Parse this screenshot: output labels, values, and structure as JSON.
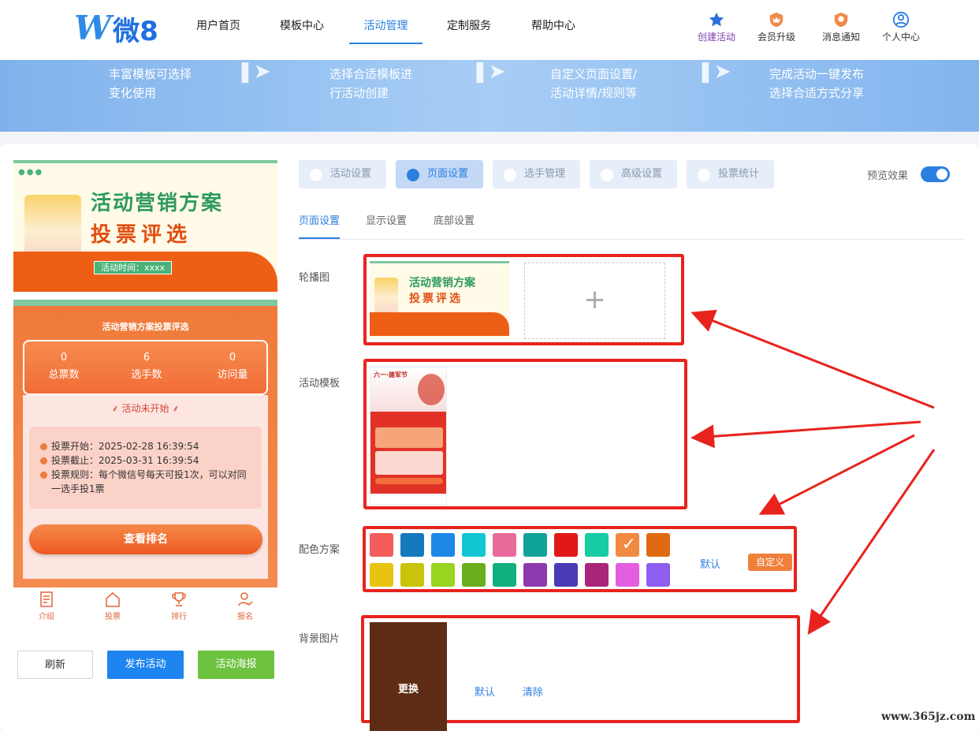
{
  "logo": {
    "w": "W",
    "text": "微8"
  },
  "nav": [
    "用户首页",
    "模板中心",
    "活动管理",
    "定制服务",
    "帮助中心"
  ],
  "user_actions": [
    "创建活动",
    "会员升级",
    "消息通知",
    "个人中心"
  ],
  "banner_steps": [
    [
      "丰富模板可选择",
      "变化使用"
    ],
    [
      "选择合适模板进",
      "行活动创建"
    ],
    [
      "自定义页面设置/",
      "活动详情/规则等"
    ],
    [
      "完成活动一键发布",
      "选择合适方式分享"
    ]
  ],
  "preview": {
    "cover_title1": "活动营销方案",
    "cover_title2": "投票评选",
    "cover_badge": "活动时间：xxxx",
    "page_title": "活动营销方案投票评选",
    "stats": [
      {
        "value": "0",
        "label": "总票数"
      },
      {
        "value": "6",
        "label": "选手数"
      },
      {
        "value": "0",
        "label": "访问量"
      }
    ],
    "status": "活动未开始",
    "rules": [
      "投票开始：2025-02-28 16:39:54",
      "投票截止：2025-03-31 16:39:54",
      "投票规则：每个微信号每天可投1次，可以对同一选手投1票"
    ],
    "rank_button": "查看排名",
    "tabbar": [
      "介绍",
      "投票",
      "排行",
      "报名"
    ]
  },
  "actions": {
    "refresh": "刷新",
    "publish": "发布活动",
    "poster": "活动海报"
  },
  "main_tabs": [
    "活动设置",
    "页面设置",
    "选手管理",
    "高级设置",
    "投票统计"
  ],
  "preview_toggle_label": "预览效果",
  "sub_tabs": [
    "页面设置",
    "显示设置",
    "底部设置"
  ],
  "fields": {
    "carousel": "轮播图",
    "template": "活动模板",
    "color": "配色方案",
    "background": "背景图片"
  },
  "upload_plus": "+",
  "colors_row1": [
    "#f25c5c",
    "#1479bd",
    "#1e87e8",
    "#12c6d3",
    "#e86a9a",
    "#10a39a",
    "#e11818",
    "#16cca4",
    "#f28a42",
    "#e06a12"
  ],
  "colors_row2": [
    "#e8c310",
    "#c9c309",
    "#98d420",
    "#6aad1d",
    "#0fb07e",
    "#8e3aaf",
    "#4a3ab6",
    "#a9257a",
    "#e35ee0",
    "#8e5ef0"
  ],
  "selected_color_check": "✓",
  "color_default": "默认",
  "color_custom": "自定义",
  "bg_change": "更换",
  "bg_default": "默认",
  "bg_clear": "清除",
  "template_thumb": {
    "title": "六一·建军节"
  },
  "watermark": "www.365jz.com"
}
